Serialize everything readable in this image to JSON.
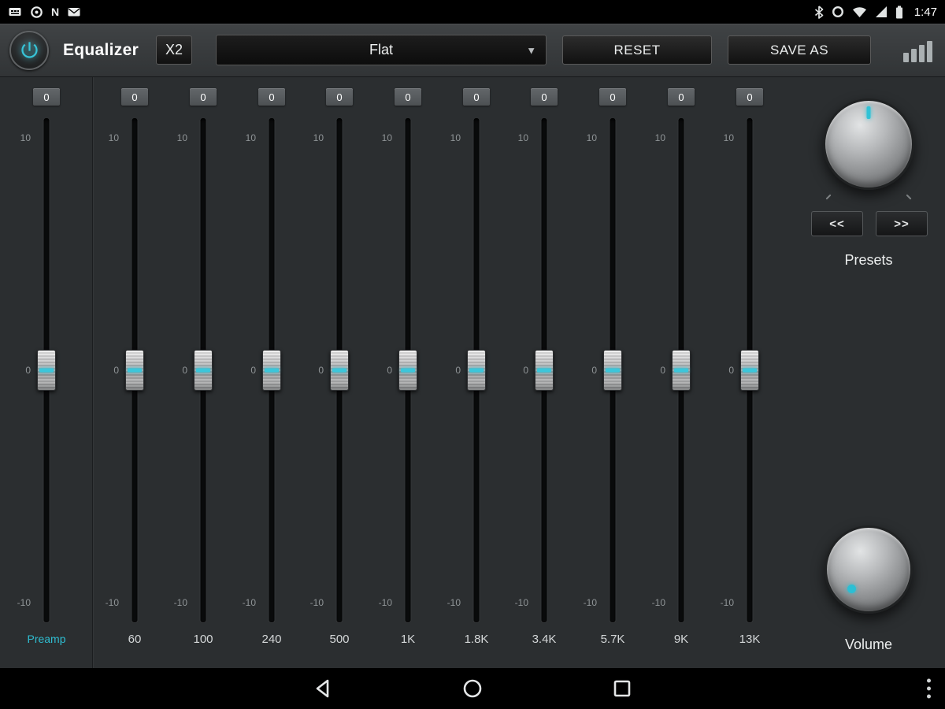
{
  "status_bar": {
    "time": "1:47",
    "nfc_label": "N"
  },
  "header": {
    "title": "Equalizer",
    "x2_label": "X2",
    "preset_dropdown_value": "Flat",
    "dropdown_arrow": "▼",
    "reset_label": "RESET",
    "save_as_label": "SAVE AS"
  },
  "eq": {
    "scale": {
      "top": "10",
      "mid": "0",
      "bottom": "-10"
    },
    "preamp": {
      "label": "Preamp",
      "value": "0"
    },
    "bands": [
      {
        "freq": "60",
        "value": "0"
      },
      {
        "freq": "100",
        "value": "0"
      },
      {
        "freq": "240",
        "value": "0"
      },
      {
        "freq": "500",
        "value": "0"
      },
      {
        "freq": "1K",
        "value": "0"
      },
      {
        "freq": "1.8K",
        "value": "0"
      },
      {
        "freq": "3.4K",
        "value": "0"
      },
      {
        "freq": "5.7K",
        "value": "0"
      },
      {
        "freq": "9K",
        "value": "0"
      },
      {
        "freq": "13K",
        "value": "0"
      }
    ]
  },
  "presets": {
    "label": "Presets",
    "prev_label": "<<",
    "next_label": ">>"
  },
  "volume": {
    "label": "Volume"
  },
  "colors": {
    "accent": "#35c4d8",
    "background": "#2b2e30",
    "bar_background": "#000000"
  }
}
